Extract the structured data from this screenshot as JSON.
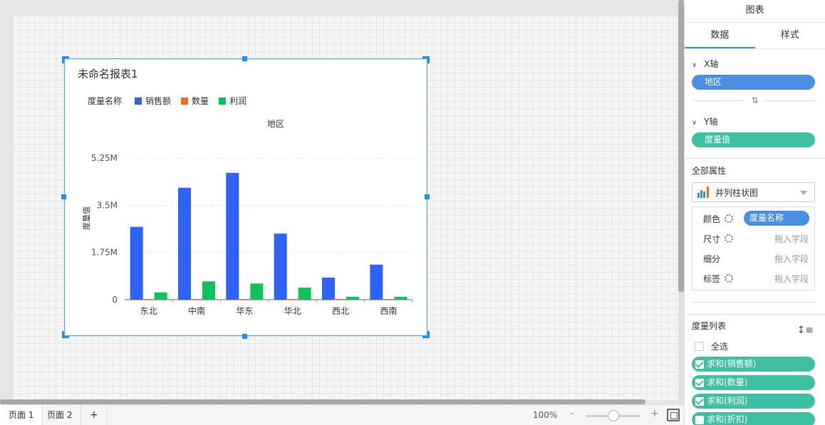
{
  "chart_card": {
    "title": "未命名报表1",
    "legend_title": "度量名称",
    "top_axis_label": "地区"
  },
  "chart_data": {
    "type": "bar",
    "title": "未命名报表1",
    "xlabel": "地区",
    "ylabel": "度量值",
    "categories": [
      "东北",
      "中南",
      "华东",
      "华北",
      "西北",
      "西南"
    ],
    "series": [
      {
        "name": "销售额",
        "color": "#2e63f7",
        "values": [
          2700000,
          4150000,
          4700000,
          2450000,
          820000,
          1300000
        ]
      },
      {
        "name": "数量",
        "color": "#f26b1d",
        "values": [
          12000,
          20000,
          25000,
          12000,
          4000,
          7000
        ]
      },
      {
        "name": "利润",
        "color": "#10c25a",
        "values": [
          270000,
          680000,
          600000,
          450000,
          110000,
          110000
        ]
      }
    ],
    "y_ticks": [
      {
        "value": 0,
        "label": "0"
      },
      {
        "value": 1750000,
        "label": "1.75M"
      },
      {
        "value": 3500000,
        "label": "3.5M"
      },
      {
        "value": 5250000,
        "label": "5.25M"
      }
    ],
    "ylim": [
      0,
      5250000
    ],
    "grid": true,
    "legend": "top-left"
  },
  "bottom_bar": {
    "pages": [
      "页面 1",
      "页面 2"
    ],
    "add_page": "+",
    "zoom": "100%",
    "zoom_minus": "-",
    "zoom_plus": "+",
    "zoom_level": 0.5
  },
  "panel": {
    "title": "图表",
    "tabs": [
      "数据",
      "样式"
    ],
    "x_axis": {
      "label": "X轴",
      "field": "地区"
    },
    "swap_symbol": "⇅",
    "y_axis": {
      "label": "Y轴",
      "field": "度量值"
    },
    "all_props": "全部属性",
    "chart_type": "并列柱状图",
    "props": {
      "color": {
        "label": "颜色",
        "field": "度量名称"
      },
      "size": {
        "label": "尺寸",
        "placeholder": "拖入字段"
      },
      "detail": {
        "label": "细分",
        "placeholder": "拖入字段"
      },
      "tag": {
        "label": "标签",
        "placeholder": "拖入字段"
      }
    },
    "measures_title": "度量列表",
    "select_all": "全选",
    "measures": [
      {
        "label": "求和(销售额)",
        "checked": true
      },
      {
        "label": "求和(数量)",
        "checked": true
      },
      {
        "label": "求和(利润)",
        "checked": true
      },
      {
        "label": "求和(折扣)",
        "checked": false
      }
    ]
  }
}
